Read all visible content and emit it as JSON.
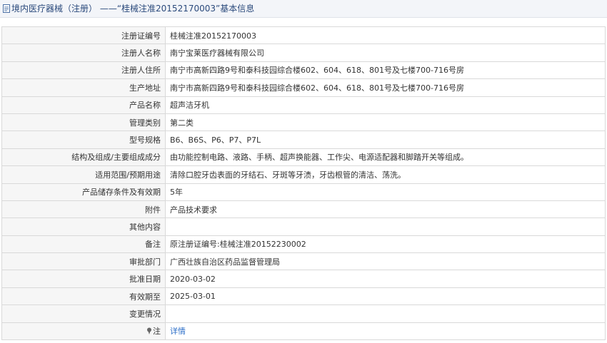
{
  "title": "境内医疗器械（注册） ——“桂械注准20152170003”基本信息",
  "rows": [
    {
      "label": "注册证编号",
      "value": "桂械注准20152170003"
    },
    {
      "label": "注册人名称",
      "value": "南宁宝莱医疗器械有限公司"
    },
    {
      "label": "注册人住所",
      "value": "南宁市高新四路9号和泰科技园综合楼602、604、618、801号及七楼700-716号房"
    },
    {
      "label": "生产地址",
      "value": "南宁市高新四路9号和泰科技园综合楼602、604、618、801号及七楼700-716号房"
    },
    {
      "label": "产品名称",
      "value": "超声洁牙机"
    },
    {
      "label": "管理类别",
      "value": "第二类"
    },
    {
      "label": "型号规格",
      "value": "B6、B6S、P6、P7、P7L"
    },
    {
      "label": "结构及组成/主要组成成分",
      "value": "由功能控制电路、液路、手柄、超声换能器、工作尖、电源适配器和脚踏开关等组成。"
    },
    {
      "label": "适用范围/预期用途",
      "value": "清除口腔牙齿表面的牙结石、牙斑等牙渍，牙齿根管的清洁、荡洗。"
    },
    {
      "label": "产品储存条件及有效期",
      "value": "5年"
    },
    {
      "label": "附件",
      "value": "产品技术要求"
    },
    {
      "label": "其他内容",
      "value": ""
    },
    {
      "label": "备注",
      "value": "原注册证编号:桂械注准20152230002"
    },
    {
      "label": "审批部门",
      "value": "广西壮族自治区药品监督管理局"
    },
    {
      "label": "批准日期",
      "value": "2020-03-02"
    },
    {
      "label": "有效期至",
      "value": "2025-03-01"
    },
    {
      "label": "变更情况",
      "value": ""
    }
  ],
  "note_row": {
    "label": "注",
    "link": "详情"
  }
}
